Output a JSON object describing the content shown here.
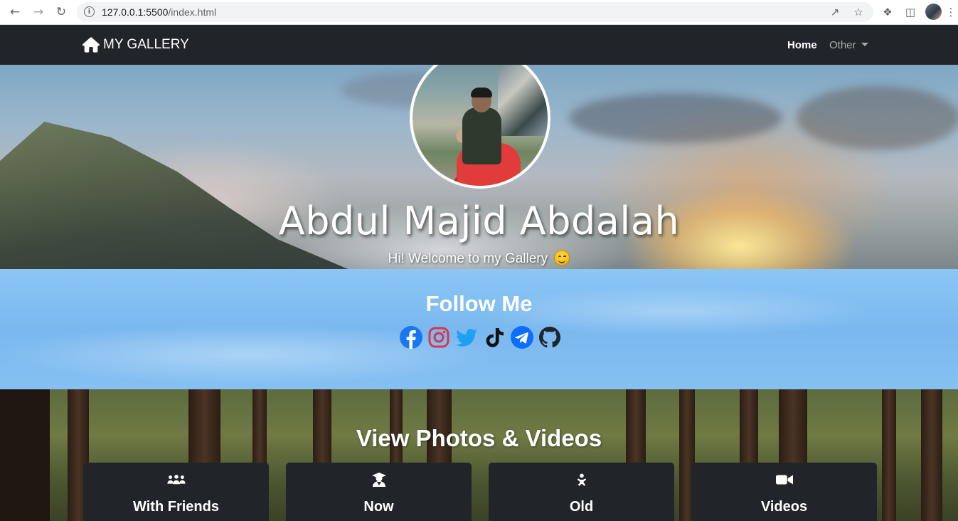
{
  "browser": {
    "url_host": "127.0.0.1:5500",
    "url_path": "/index.html"
  },
  "navbar": {
    "brand": "MY GALLERY",
    "brand_icon": "home-icon",
    "links": {
      "home": "Home",
      "other": "Other"
    }
  },
  "hero": {
    "name": "Abdul Majid Abdalah",
    "subtitle": "Hi! Welcome to my Gallery"
  },
  "follow": {
    "title": "Follow Me",
    "socials": [
      "facebook-icon",
      "instagram-icon",
      "twitter-icon",
      "tiktok-icon",
      "telegram-icon",
      "github-icon"
    ],
    "colors": {
      "facebook": "#1877f2",
      "instagram": "#dc3545",
      "twitter": "#1da1f2",
      "tiktok": "#000000",
      "telegram": "#0d6efd",
      "github": "#212529"
    }
  },
  "gallery": {
    "title": "View Photos & Videos",
    "cards": [
      {
        "label": "With Friends",
        "icon": "people-group-icon"
      },
      {
        "label": "Now",
        "icon": "user-graduate-icon"
      },
      {
        "label": "Old",
        "icon": "baby-icon"
      },
      {
        "label": "Videos",
        "icon": "video-camera-icon"
      }
    ]
  },
  "colors": {
    "navbar_bg": "#212529",
    "card_bg": "#212529"
  }
}
